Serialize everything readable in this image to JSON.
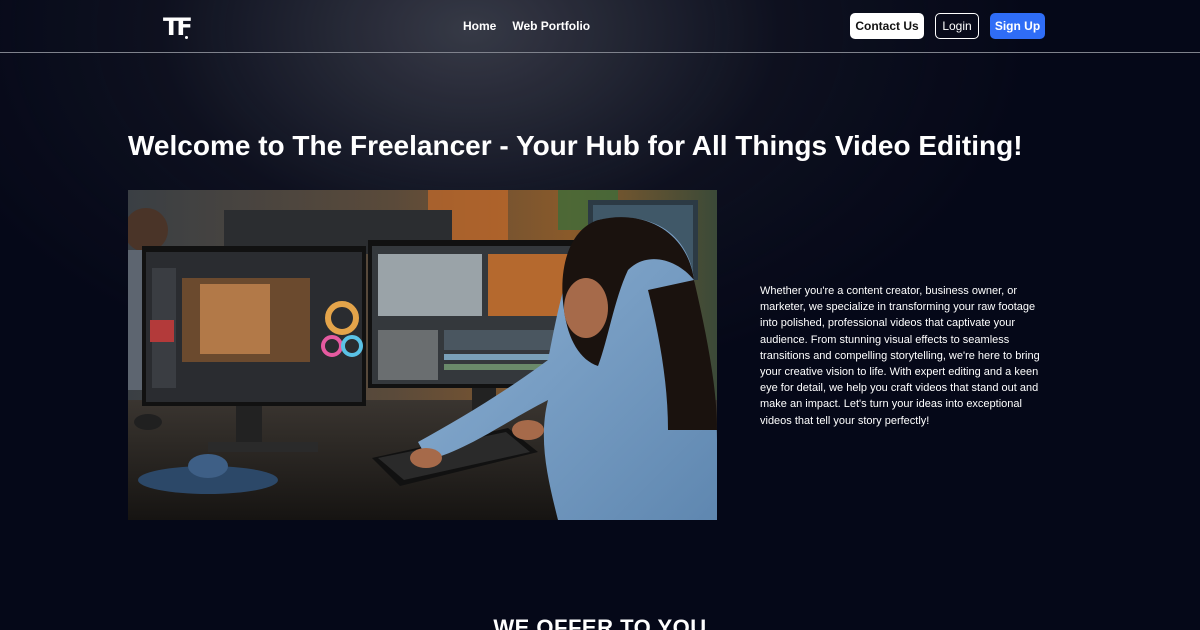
{
  "brand": {
    "logo_text": "TF"
  },
  "nav": {
    "links": [
      {
        "label": "Home"
      },
      {
        "label": "Web Portfolio"
      }
    ],
    "contact_label": "Contact Us",
    "login_label": "Login",
    "signup_label": "Sign Up"
  },
  "hero": {
    "title": "Welcome to The Freelancer - Your Hub for All Things Video Editing!",
    "description": "Whether you're a content creator, business owner, or marketer, we specialize in transforming your raw footage into polished, professional videos that captivate your audience. From stunning visual effects to seamless transitions and compelling storytelling, we're here to bring your creative vision to life. With expert editing and a keen eye for detail, we help you craft videos that stand out and make an impact. Let's turn your ideas into exceptional videos that tell your story perfectly!",
    "image_alt": "Video editor working at dual monitors"
  },
  "offer": {
    "heading": "WE OFFER TO YOU"
  },
  "colors": {
    "background": "#050818",
    "accent": "#2f6df6",
    "nav_border": "#7f828c"
  }
}
